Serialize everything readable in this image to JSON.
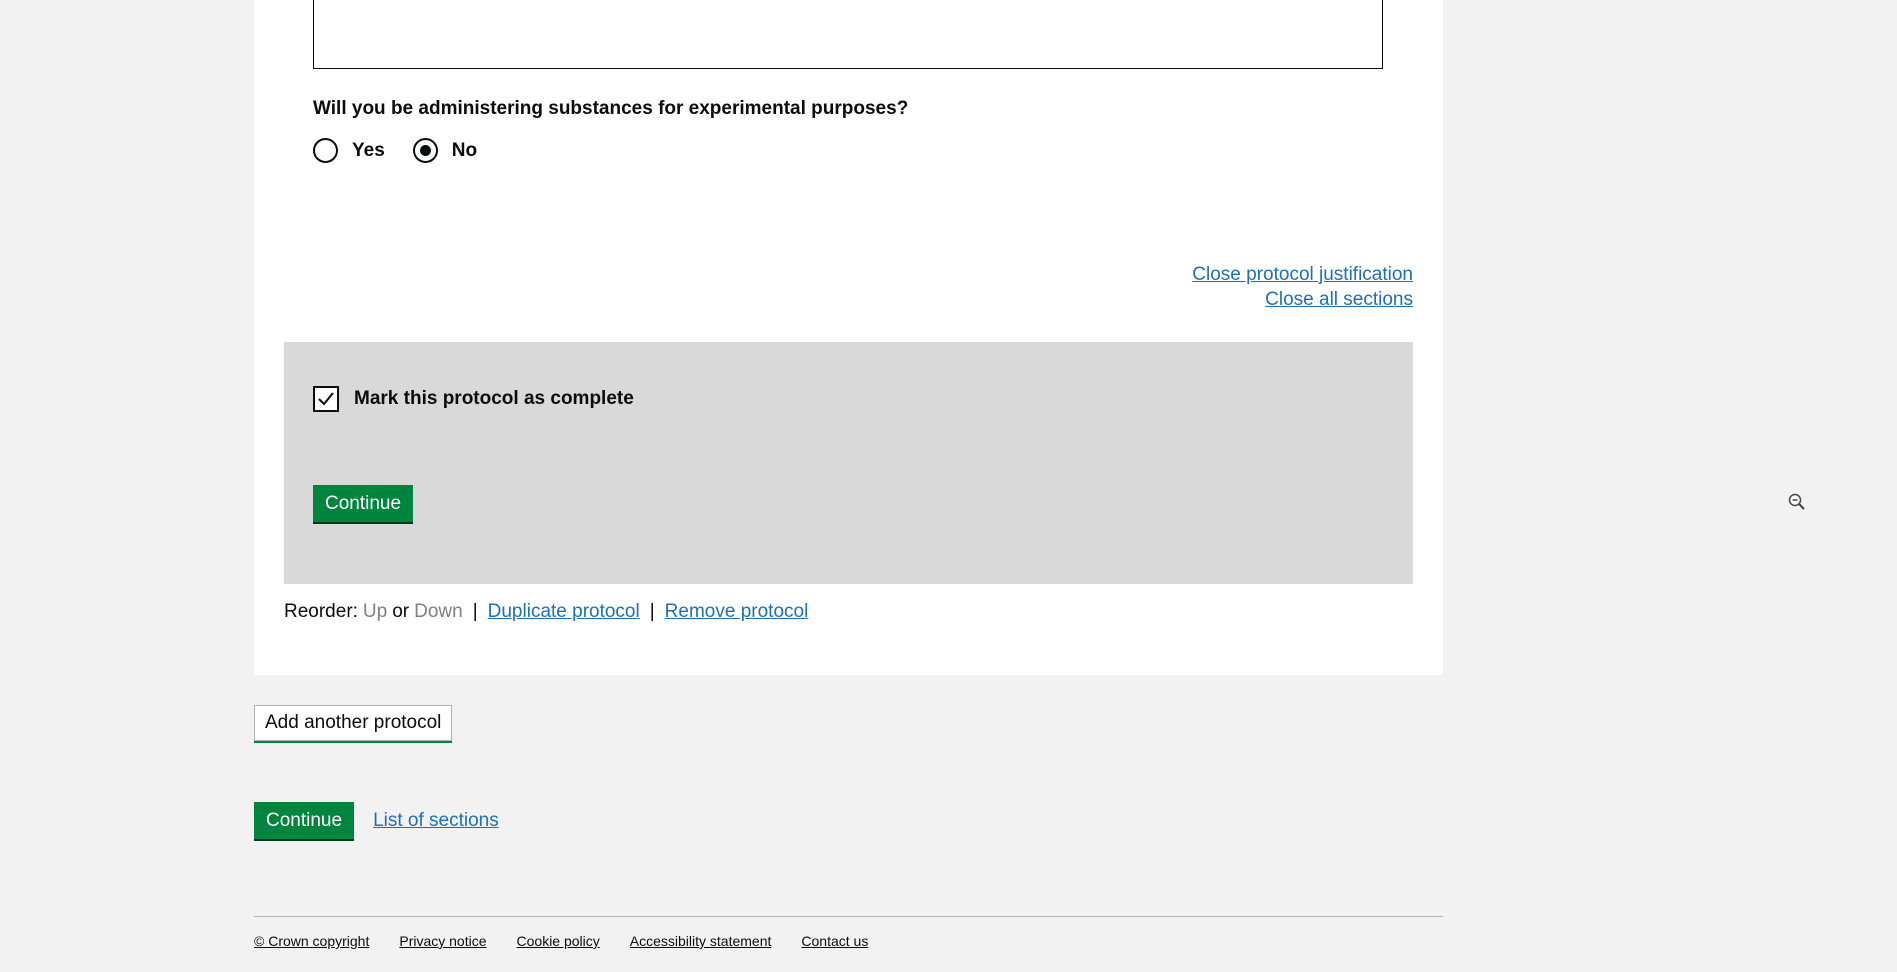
{
  "question": {
    "text": "Will you be administering substances for experimental purposes?",
    "options": [
      {
        "label": "Yes",
        "checked": false
      },
      {
        "label": "No",
        "checked": true
      }
    ]
  },
  "links": {
    "close_protocol": "Close protocol justification",
    "close_all": "Close all sections"
  },
  "complete": {
    "label": "Mark this protocol as complete",
    "checked": true,
    "continue_label": "Continue"
  },
  "reorder": {
    "prefix": "Reorder:",
    "up": "Up",
    "or": "or",
    "down": "Down",
    "separator": "|",
    "duplicate": "Duplicate protocol",
    "remove": "Remove protocol"
  },
  "add_another": "Add another protocol",
  "bottom": {
    "continue_label": "Continue",
    "list_of_sections": "List of sections"
  },
  "footer": {
    "links": [
      "© Crown copyright",
      "Privacy notice",
      "Cookie policy",
      "Accessibility statement",
      "Contact us"
    ]
  },
  "icons": {
    "checkmark": "check-icon",
    "zoom_out": "zoom-out-icon"
  },
  "colors": {
    "link": "#1d70b8",
    "button_green": "#00853f",
    "panel_grey": "#d9d9d9",
    "page_bg": "#f2f2f2"
  }
}
